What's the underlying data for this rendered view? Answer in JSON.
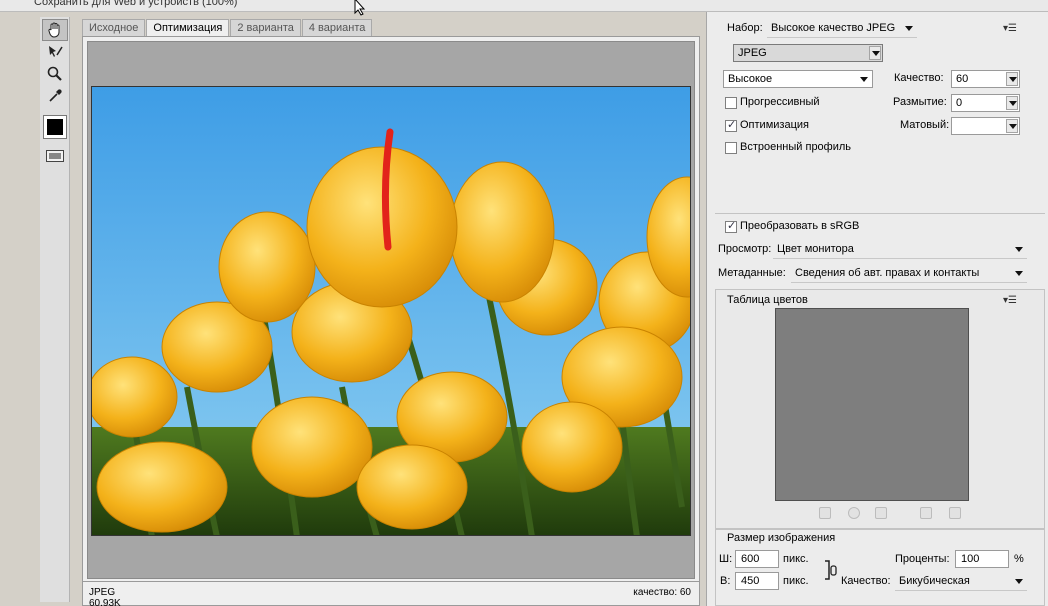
{
  "window": {
    "title": "Сохранить для Web и устройств (100%)"
  },
  "tools": [
    {
      "name": "hand-tool-icon"
    },
    {
      "name": "slice-select-tool-icon"
    },
    {
      "name": "zoom-tool-icon"
    },
    {
      "name": "eyedropper-tool-icon"
    }
  ],
  "tabs": [
    {
      "label": "Исходное",
      "active": false
    },
    {
      "label": "Оптимизация",
      "active": true
    },
    {
      "label": "2 варианта",
      "active": false
    },
    {
      "label": "4 варианта",
      "active": false
    }
  ],
  "status": {
    "format": "JPEG",
    "size": "60,93K",
    "quality_text": "качество: 60"
  },
  "panel": {
    "preset_label": "Набор:",
    "preset_value": "Высокое качество JPEG",
    "format_value": "JPEG",
    "quality_level_value": "Высокое",
    "quality_label": "Качество:",
    "quality_value": "60",
    "progressive_label": "Прогрессивный",
    "progressive_checked": false,
    "blur_label": "Размытие:",
    "blur_value": "0",
    "optimized_label": "Оптимизация",
    "optimized_checked": true,
    "matte_label": "Матовый:",
    "matte_value": "",
    "embed_profile_label": "Встроенный профиль",
    "embed_profile_checked": false,
    "srgb_label": "Преобразовать в sRGB",
    "srgb_checked": true,
    "preview_label": "Просмотр:",
    "preview_value": "Цвет монитора",
    "metadata_label": "Метаданные:",
    "metadata_value": "Сведения об авт. правах и контакты",
    "color_table_label": "Таблица цветов",
    "image_size_label": "Размер изображения",
    "width_label": "Ш:",
    "width_value": "600",
    "height_label": "В:",
    "height_value": "450",
    "unit_px": "пикс.",
    "percent_label": "Проценты:",
    "percent_value": "100",
    "percent_sign": "%",
    "resample_label": "Качество:",
    "resample_value": "Бикубическая"
  },
  "colors": {
    "accent": "#3b7dd8",
    "sky": "#45a8ea",
    "tulip": "#f2b51a",
    "stem": "#3c5e1c"
  }
}
